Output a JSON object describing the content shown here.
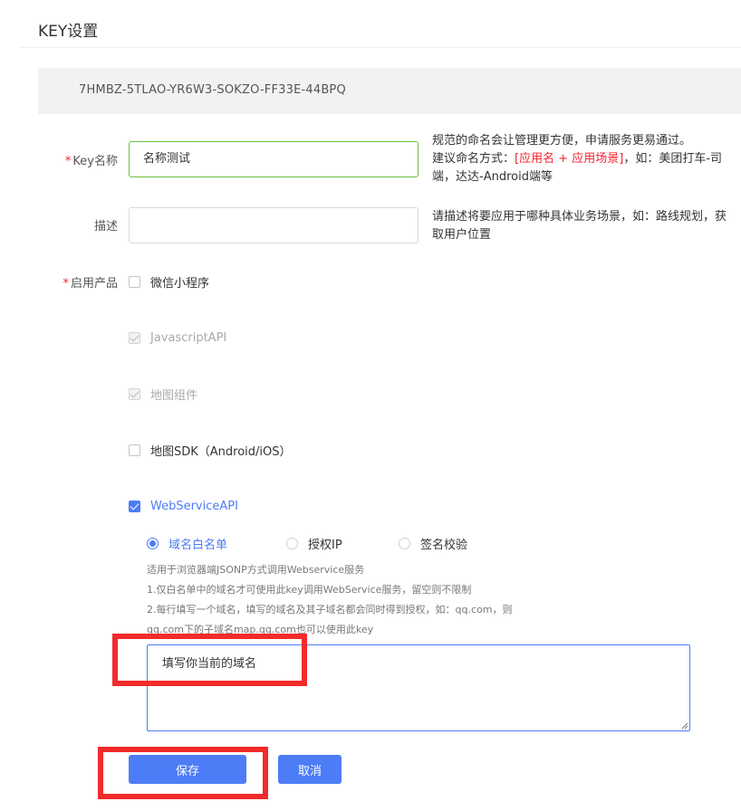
{
  "page": {
    "title": "KEY设置"
  },
  "key": {
    "value": "7HMBZ-5TLAO-YR6W3-SOKZO-FF33E-44BPQ"
  },
  "form": {
    "key_name": {
      "required_mark": "*",
      "label": "Key名称",
      "value": "名称测试",
      "hint_line1": "规范的命名会让管理更方便，申请服务更易通过。",
      "hint_line2_prefix": "建议命名方式：",
      "hint_line2_red": "[应用名 + 应用场景]",
      "hint_line2_suffix": "，如：美团打车-司",
      "hint_line3": "端，达达-Android端等"
    },
    "description": {
      "label": "描述",
      "value": "",
      "hint_line1": "请描述将要应用于哪种具体业务场景，如：路线规划，获",
      "hint_line2": "取用户位置"
    },
    "products": {
      "required_mark": "*",
      "label": "启用产品",
      "items": [
        {
          "label": "微信小程序",
          "state": "unchecked"
        },
        {
          "label": "JavascriptAPI",
          "state": "disabled-checked"
        },
        {
          "label": "地图组件",
          "state": "disabled-checked"
        },
        {
          "label": "地图SDK（Android/iOS）",
          "state": "unchecked"
        },
        {
          "label": "WebServiceAPI",
          "state": "checked"
        }
      ]
    },
    "webservice": {
      "radios": [
        {
          "label": "域名白名单",
          "selected": true
        },
        {
          "label": "授权IP",
          "selected": false
        },
        {
          "label": "签名校验",
          "selected": false
        }
      ],
      "desc_line1": "适用于浏览器端JSONP方式调用Webservice服务",
      "desc_line2": "1.仅白名单中的域名才可使用此key调用WebService服务，留空则不限制",
      "desc_line3": "2.每行填写一个域名，填写的域名及其子域名都会同时得到授权，如：qq.com，则",
      "desc_line4": "qq.com下的子域名map.qq.com也可以使用此key",
      "textarea_value": "填写你当前的域名"
    }
  },
  "actions": {
    "save_label": "保存",
    "cancel_label": "取消"
  },
  "colors": {
    "primary": "#4d7cf7",
    "required": "#f5222d",
    "highlight": "#f22b2b",
    "focus_border": "#67c23a"
  }
}
